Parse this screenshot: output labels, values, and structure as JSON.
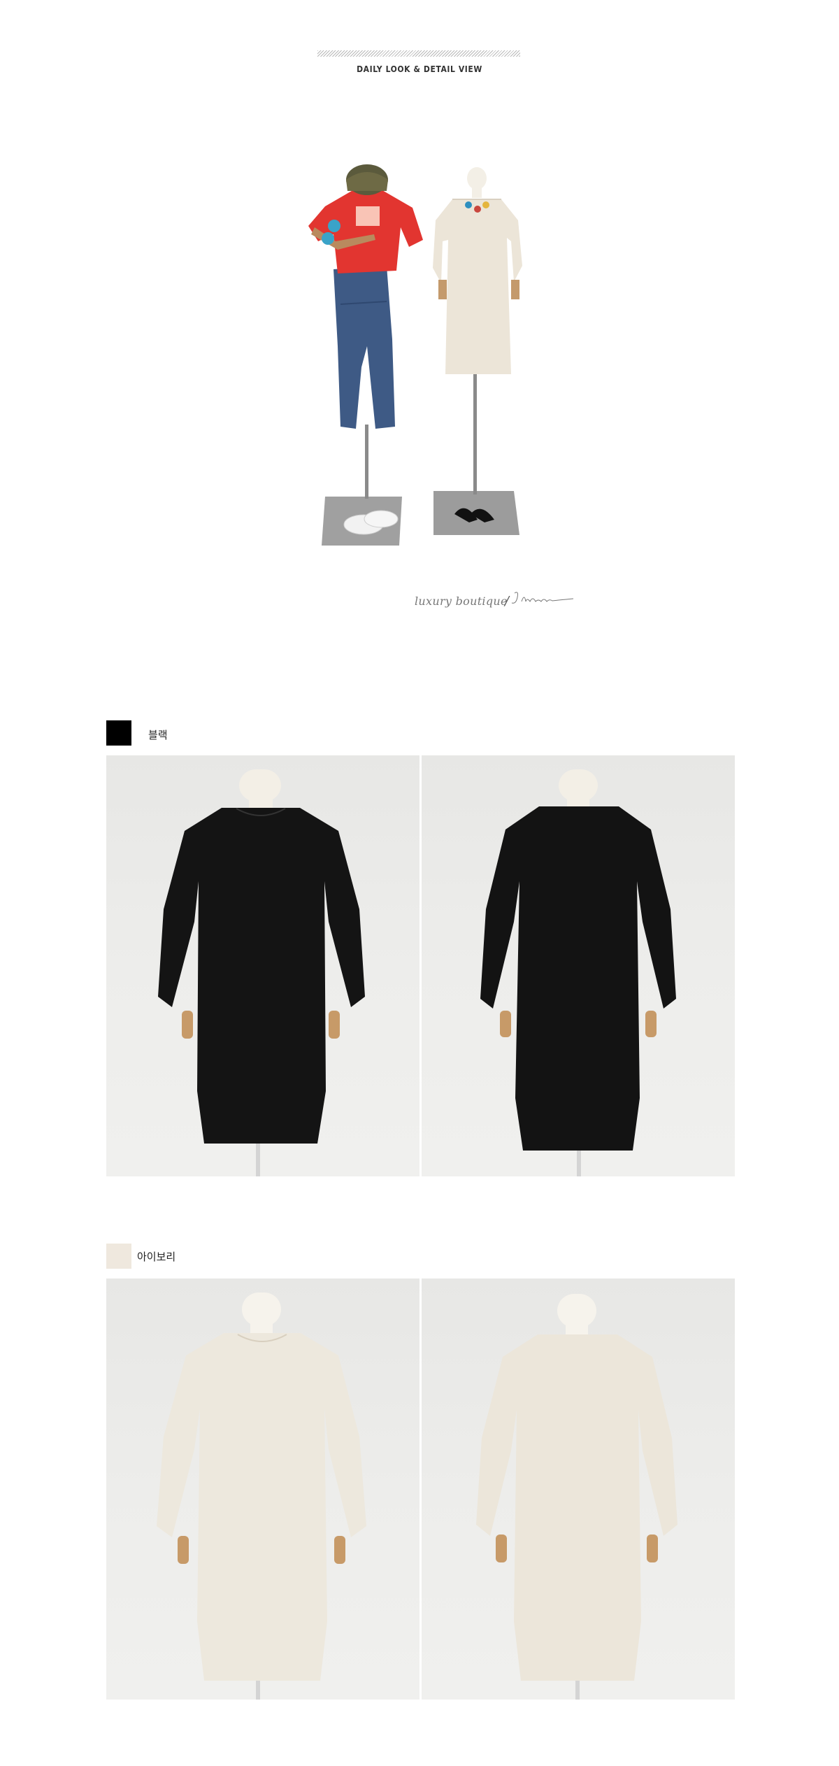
{
  "header": {
    "title": "DAILY LOOK & DETAIL VIEW"
  },
  "signature": {
    "tagline": "luxury boutique",
    "slash": "/",
    "brand_script": "Jblanc"
  },
  "colors": [
    {
      "label": "블랙",
      "swatch_color": "#000000",
      "garment_color": "#141414"
    },
    {
      "label": "아이보리",
      "swatch_color": "#efe8de",
      "garment_color": "#ede8dd"
    }
  ]
}
